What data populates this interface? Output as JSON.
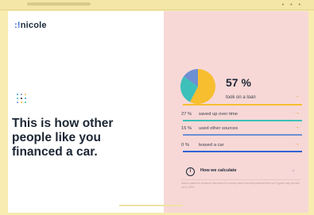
{
  "brand": {
    "logo_text": "nicole",
    "logo_mark": ":!"
  },
  "hero": {
    "headline_lines": [
      "This is how other",
      "people like you",
      "financed a car."
    ]
  },
  "chart_data": {
    "type": "pie",
    "categories": [
      "took on a loan",
      "saved up over time",
      "used other sources",
      "leased a car"
    ],
    "values": [
      57,
      27,
      15,
      0
    ],
    "colors": [
      "#f7be2f",
      "#3cc0b9",
      "#6d8fd3",
      "#2f63d6"
    ]
  },
  "main_stat": {
    "value": "57 %",
    "label": "took on a loan",
    "arrow": "→"
  },
  "stats": [
    {
      "pct": "27 %",
      "label": "saved up over time",
      "arrow": "→"
    },
    {
      "pct": "15 %",
      "label": "used other sources",
      "arrow": "→"
    },
    {
      "pct": "0 %",
      "label": "leased a car",
      "arrow": "→"
    }
  ],
  "calc": {
    "label": "How we calculate",
    "icon": "info-icon",
    "chevron": "chevron-down-icon"
  },
  "fineprint": "Data is based on customer responses to a survey about how they financed their car. Figures may not add up to 100%."
}
